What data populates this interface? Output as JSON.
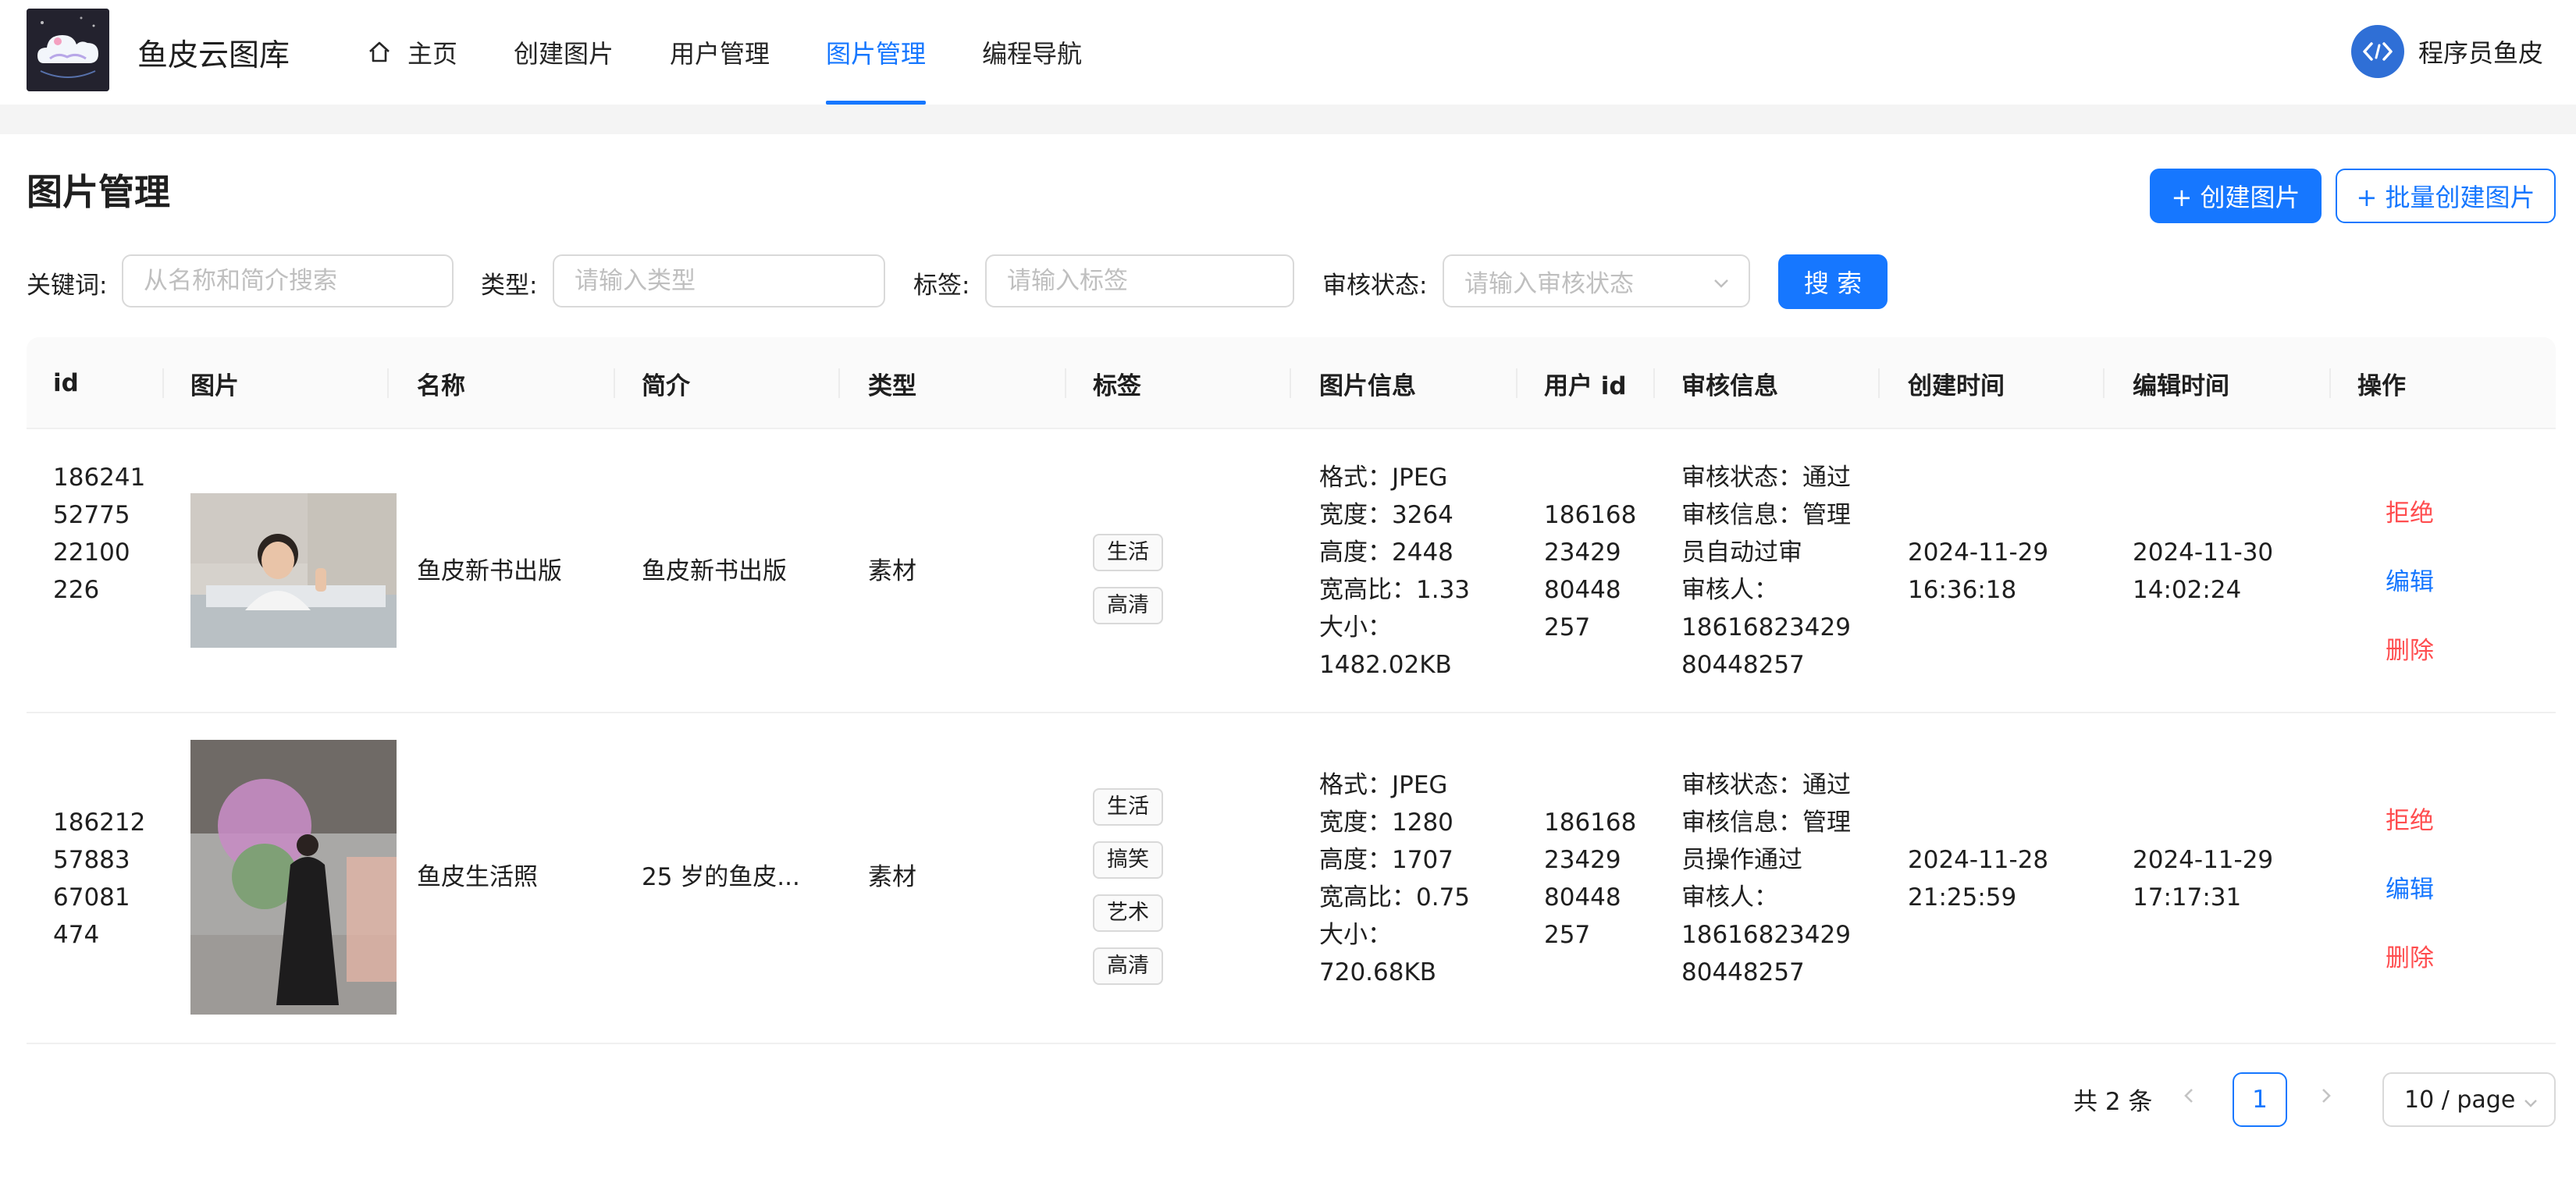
{
  "header": {
    "site_name": "鱼皮云图库",
    "nav": [
      {
        "label": "主页",
        "icon": "home-icon"
      },
      {
        "label": "创建图片"
      },
      {
        "label": "用户管理"
      },
      {
        "label": "图片管理",
        "active": true
      },
      {
        "label": "编程导航"
      }
    ],
    "user_name": "程序员鱼皮"
  },
  "page": {
    "title": "图片管理",
    "create_button": "+ 创建图片",
    "batch_create_button": "+ 批量创建图片"
  },
  "filters": {
    "keyword_label": "关键词",
    "keyword_placeholder": "从名称和简介搜索",
    "type_label": "类型",
    "type_placeholder": "请输入类型",
    "tag_label": "标签",
    "tag_placeholder": "请输入标签",
    "review_label": "审核状态",
    "review_placeholder": "请输入审核状态",
    "search_button": "搜 索"
  },
  "table": {
    "columns": [
      "id",
      "图片",
      "名称",
      "简介",
      "类型",
      "标签",
      "图片信息",
      "用户 id",
      "审核信息",
      "创建时间",
      "编辑时间",
      "操作"
    ],
    "rows": [
      {
        "id": [
          "186241",
          "52775",
          "22100",
          "226"
        ],
        "name": "鱼皮新书出版",
        "intro": "鱼皮新书出版",
        "type": "素材",
        "tags": [
          "生活",
          "高清"
        ],
        "info": [
          "格式：JPEG",
          "宽度：3264",
          "高度：2448",
          "宽高比：1.33",
          "大小：",
          "1482.02KB"
        ],
        "user_id": [
          "186168",
          "23429",
          "80448",
          "257"
        ],
        "review": [
          "审核状态：通过",
          "审核信息：管理",
          "员自动过审",
          "审核人：",
          "18616823429",
          "80448257"
        ],
        "created": [
          "2024-11-29",
          "16:36:18"
        ],
        "edited": [
          "2024-11-30",
          "14:02:24"
        ],
        "actions": [
          "拒绝",
          "编辑",
          "删除"
        ]
      },
      {
        "id": [
          "186212",
          "57883",
          "67081",
          "474"
        ],
        "name": "鱼皮生活照",
        "intro": "25 岁的鱼皮...",
        "type": "素材",
        "tags": [
          "生活",
          "搞笑",
          "艺术",
          "高清"
        ],
        "info": [
          "格式：JPEG",
          "宽度：1280",
          "高度：1707",
          "宽高比：0.75",
          "大小：",
          "720.68KB"
        ],
        "user_id": [
          "186168",
          "23429",
          "80448",
          "257"
        ],
        "review": [
          "审核状态：通过",
          "审核信息：管理",
          "员操作通过",
          "审核人：",
          "18616823429",
          "80448257"
        ],
        "created": [
          "2024-11-28",
          "21:25:59"
        ],
        "edited": [
          "2024-11-29",
          "17:17:31"
        ],
        "actions": [
          "拒绝",
          "编辑",
          "删除"
        ]
      }
    ]
  },
  "pagination": {
    "total_text": "共 2 条",
    "current_page": "1",
    "page_size": "10 / page"
  },
  "colors": {
    "accent": "#1677ff",
    "danger": "#ff4d4f"
  }
}
